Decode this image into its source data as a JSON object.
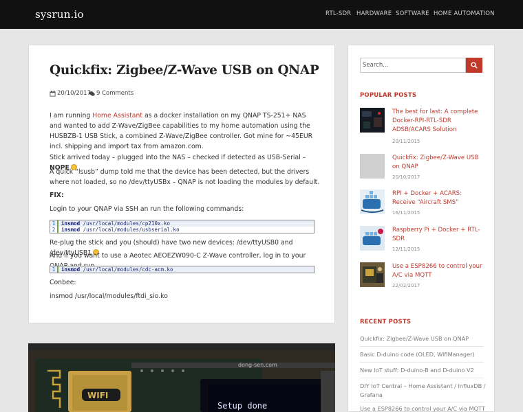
{
  "site": {
    "brand": "sysrun.io"
  },
  "nav": [
    "RTL-SDR",
    "HARDWARE",
    "SOFTWARE",
    "HOME AUTOMATION"
  ],
  "post": {
    "title": "Quickfix: Zigbee/Z-Wave USB on QNAP",
    "date": "20/10/2017",
    "comments": "9 Comments",
    "p1": {
      "a": "I am running ",
      "link": "Home Assistant",
      "b": " as a docker installation on my QNAP TS-251+ NAS and wanted to add Z-Wave/ZigBee capabilities to my home automation using the HUSBZB-1 USB Stick, a combined Z-Wave/ZigBee controller. Got mine for ~45EUR incl. shipping and import tax from amazon.com."
    },
    "p2": {
      "a": "Stick arrived today – plugged into the NAS – checked if detected as USB-Serial – ",
      "bold": "NOPE"
    },
    "p3": "A quick “lsusb” dump told me that the device has been detected, but the drivers where not loaded, so no /dev/ttyUSBx – QNAP is not loading the modules by default.",
    "fix": "FIX:",
    "p4": "Login to your QNAP via SSH an run the following commands:",
    "code1": [
      {
        "n": "1",
        "cmd": "insmod",
        "arg": " /usr/local/modules/cp210x.ko"
      },
      {
        "n": "2",
        "cmd": "insmod",
        "arg": " /usr/local/modules/usbserial.ko"
      }
    ],
    "p5": "Re-plug the stick and you (should) have two new devices: /dev/ttyUSB0 and /dev/ttyUSB1",
    "p6": "And if you want to use a Aeotec AEOEZW090-C Z-Wave controller, log in to your QNAP and run",
    "code2": [
      {
        "n": "1",
        "cmd": "insmod",
        "arg": " /usr/local/modules/cdc-acm.ko"
      }
    ],
    "p7": "Conbee:",
    "p8": "insmod /usr/local/modules/ftdi_sio.ko"
  },
  "post2_image": {
    "board_text": "dong-sen.com",
    "screen_text": "Setup done",
    "chip_text": "WIFI"
  },
  "sidebar": {
    "search_placeholder": "Search...",
    "popular_title": "POPULAR POSTS",
    "popular": [
      {
        "title": "The best for last: A complete Docker-RPI-RTL-SDR ADSB/ACARS Solution",
        "date": "20/11/2015"
      },
      {
        "title": "Quickfix: Zigbee/Z-Wave USB on QNAP",
        "date": "20/10/2017"
      },
      {
        "title": "RPI + Docker + ACARS: Receive “Aircraft SMS”",
        "date": "16/11/2015"
      },
      {
        "title": "Raspberry Pi + Docker + RTL-SDR",
        "date": "12/11/2015"
      },
      {
        "title": "Use a ESP8266 to control your A/C via MQTT",
        "date": "22/02/2017"
      }
    ],
    "recent_title": "RECENT POSTS",
    "recent": [
      "Quickfix: Zigbee/Z-Wave USB on QNAP",
      "Basic D-duino code (OLED, WifiManager)",
      "New IoT stuff: D-duino-B and D-duino V2",
      "DIY IoT Central – Home Assistant / InfluxDB / Grafana",
      "Use a ESP8266 to control your A/C via MQTT"
    ]
  },
  "colors": {
    "accent": "#c0392b",
    "header_bg": "#111111",
    "page_bg": "#e6e6e6"
  }
}
